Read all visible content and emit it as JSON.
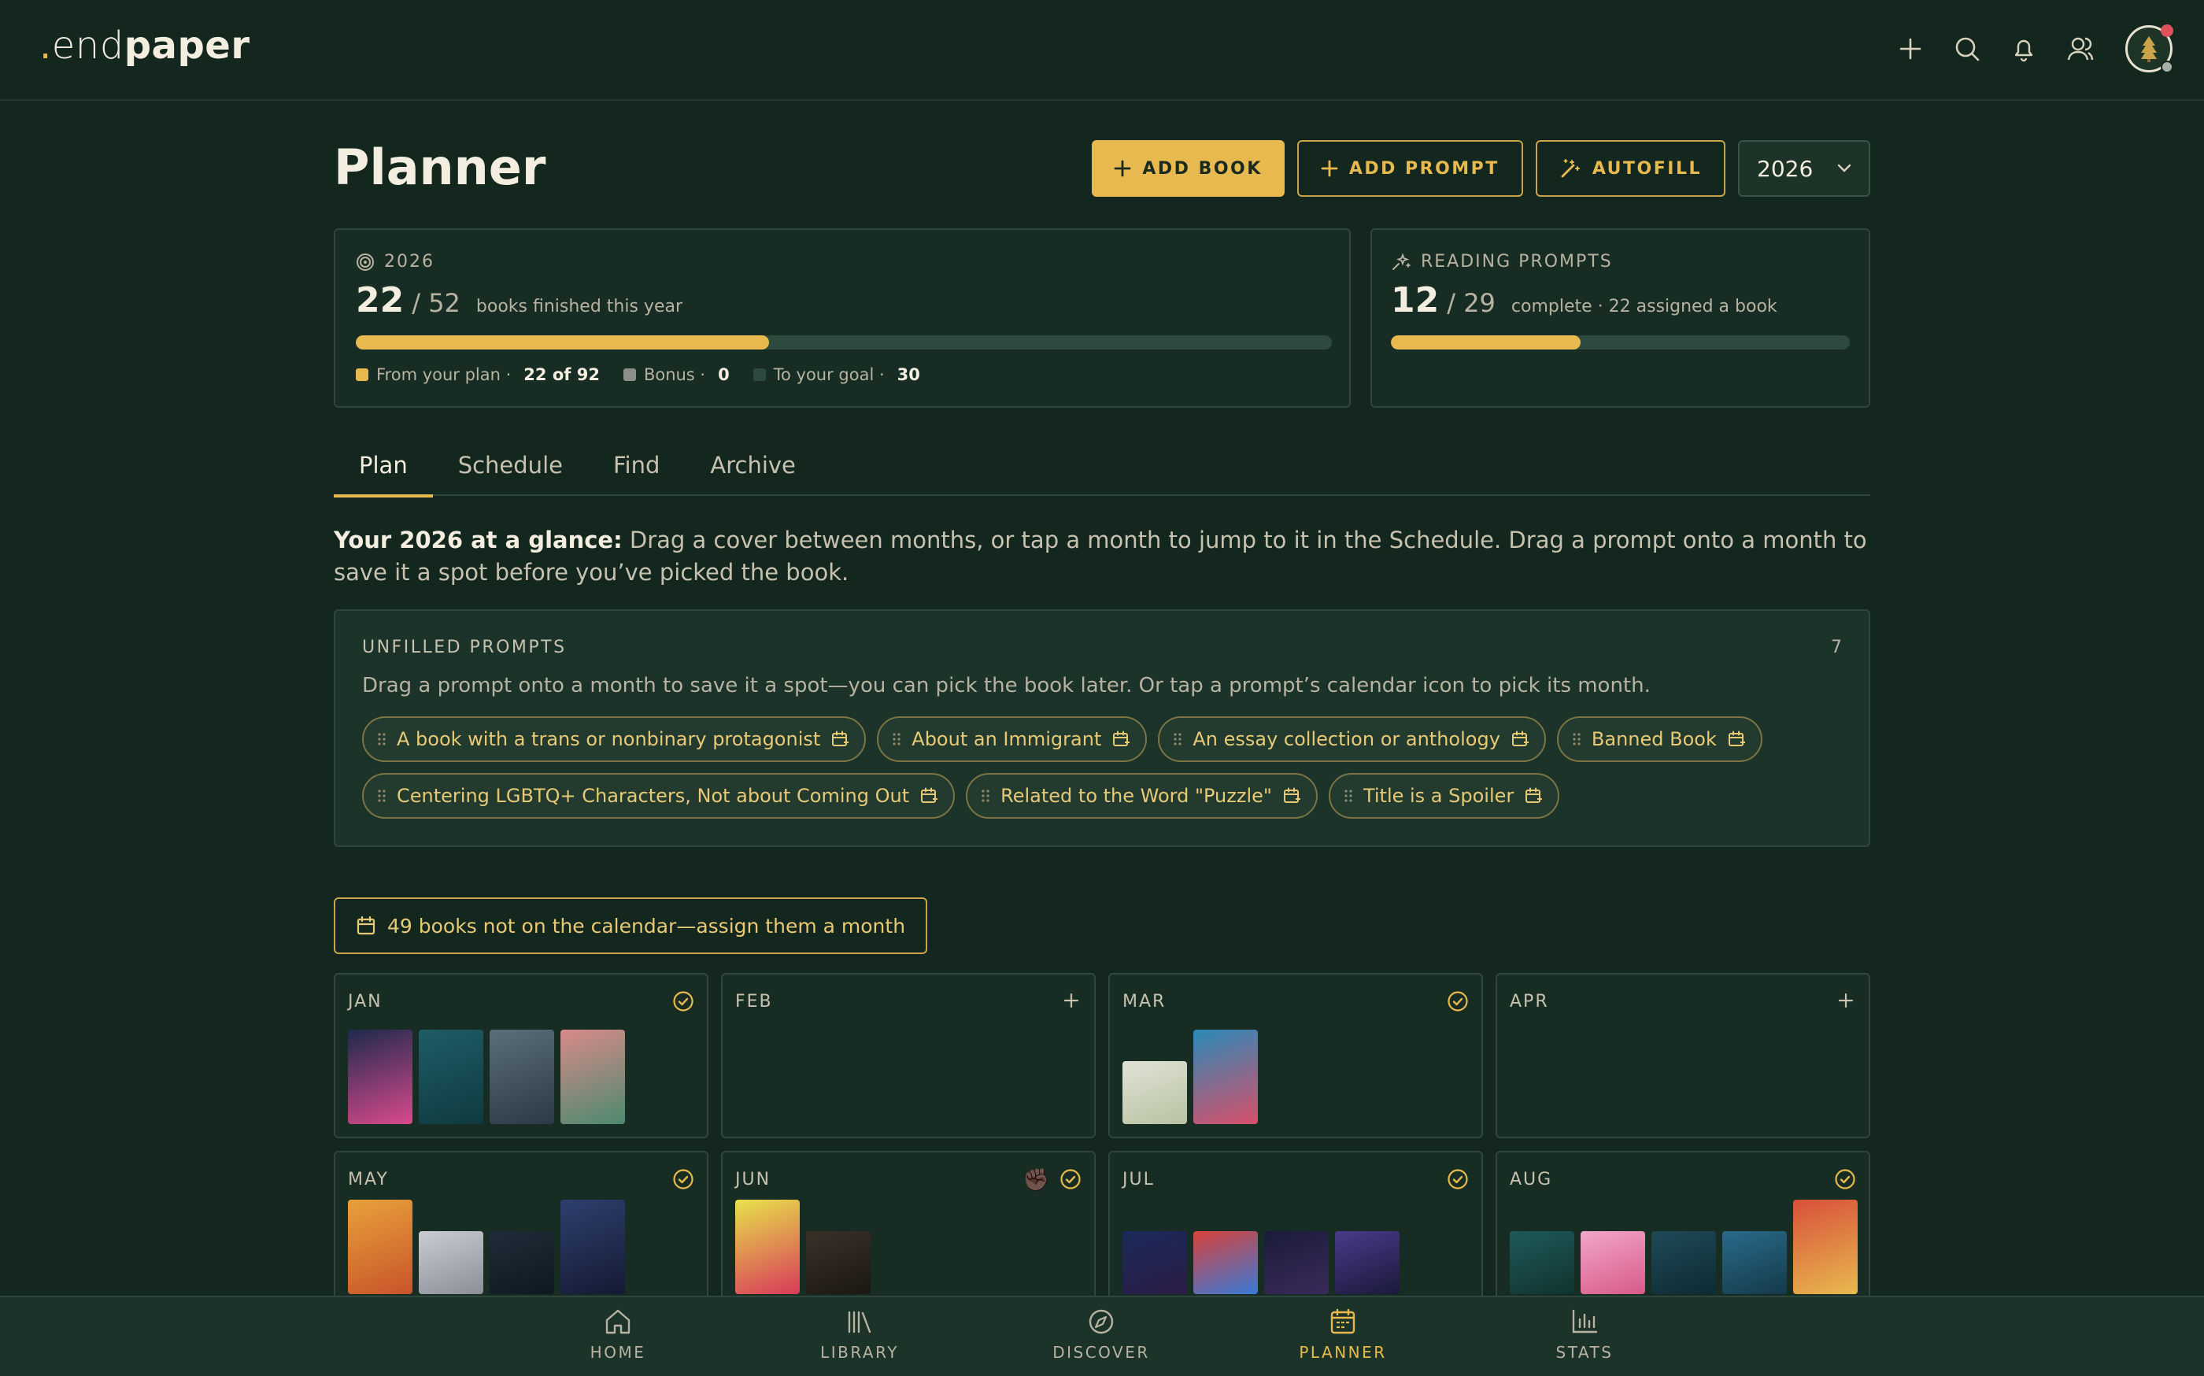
{
  "app": {
    "logo_dot": ".",
    "logo_end": "end",
    "logo_paper": "paper"
  },
  "header": {
    "title": "Planner"
  },
  "actions": {
    "add_book": "ADD BOOK",
    "add_prompt": "ADD PROMPT",
    "autofill": "AUTOFILL",
    "year": "2026"
  },
  "goal_card": {
    "label": "2026",
    "count": "22",
    "total": "/ 52",
    "caption": "books finished this year",
    "progress": 0.423,
    "legend": [
      {
        "label": "From your plan ·",
        "value": "22 of 92",
        "color": "#e8b94e"
      },
      {
        "label": "Bonus ·",
        "value": "0",
        "color": "#8c8f87"
      },
      {
        "label": "To your goal ·",
        "value": "30",
        "color": "#2e4a3e"
      }
    ]
  },
  "prompts_card": {
    "label": "READING PROMPTS",
    "count": "12",
    "total": "/ 29",
    "caption": "complete · 22 assigned a book",
    "progress": 0.414
  },
  "tabs": [
    {
      "label": "Plan",
      "active": true
    },
    {
      "label": "Schedule",
      "active": false
    },
    {
      "label": "Find",
      "active": false
    },
    {
      "label": "Archive",
      "active": false
    }
  ],
  "intro": {
    "bold": "Your 2026 at a glance:",
    "text": " Drag a cover between months, or tap a month to jump to it in the Schedule. Drag a prompt onto a month to save it a spot before you’ve picked the book."
  },
  "unfilled": {
    "title": "UNFILLED PROMPTS",
    "count": "7",
    "description": "Drag a prompt onto a month to save it a spot—you can pick the book later. Or tap a prompt’s calendar icon to pick its month.",
    "chips": [
      "A book with a trans or nonbinary protagonist",
      "About an Immigrant",
      "An essay collection or anthology",
      "Banned Book",
      "Centering LGBTQ+ Characters, Not about Coming Out",
      "Related to the Word \"Puzzle\"",
      "Title is a Spoiler"
    ]
  },
  "unassigned": {
    "label": "49 books not on the calendar—assign them a month"
  },
  "months": [
    {
      "label": "JAN",
      "icon": "check-circle-icon",
      "covers": [
        [
          "#1d2a4d",
          "#d94a8c"
        ],
        [
          "#1f5c66",
          "#0f3a40"
        ],
        [
          "#5b6e7a",
          "#2b3a44"
        ],
        [
          "#d88a8a",
          "#4d8a6e"
        ]
      ]
    },
    {
      "label": "FEB",
      "icon": "plus-icon",
      "covers": []
    },
    {
      "label": "MAR",
      "icon": "check-circle-icon",
      "covers": [
        [
          "#dfe3d6",
          "#b8c2a2"
        ],
        [
          "#2a8ab8",
          "#d8506a"
        ]
      ]
    },
    {
      "label": "APR",
      "icon": "plus-icon",
      "covers": []
    },
    {
      "label": "MAY",
      "icon": "check-circle-icon",
      "covers": [
        [
          "#e8a13a",
          "#c8542a"
        ],
        [
          "#c9ccd2",
          "#8a8f98"
        ],
        [
          "#1f2d38",
          "#0e1820"
        ],
        [
          "#2e3f6e",
          "#141a33"
        ]
      ]
    },
    {
      "label": "JUN",
      "icon": "check-circle-icon",
      "extra": "✊🏿",
      "covers": [
        [
          "#e7e24a",
          "#d83a5a"
        ],
        [
          "#3a3028",
          "#1c1712"
        ]
      ]
    },
    {
      "label": "JUL",
      "icon": "check-circle-icon",
      "covers": [
        [
          "#1a2a5a",
          "#2b1c46"
        ],
        [
          "#d8423a",
          "#3a7ad8"
        ],
        [
          "#1a1c3a",
          "#3a2a5a"
        ],
        [
          "#4a3a8a",
          "#1a1a3a"
        ]
      ]
    },
    {
      "label": "AUG",
      "icon": "check-circle-icon",
      "covers": [
        [
          "#1e5a58",
          "#103330"
        ],
        [
          "#f1a6c8",
          "#d85a8a"
        ],
        [
          "#1e4a58",
          "#0e2a33"
        ],
        [
          "#2a6a8a",
          "#143a4a"
        ],
        [
          "#d8503a",
          "#e8b94e"
        ]
      ]
    }
  ],
  "nav": [
    {
      "label": "HOME",
      "icon": "home-icon",
      "active": false
    },
    {
      "label": "LIBRARY",
      "icon": "library-icon",
      "active": false
    },
    {
      "label": "DISCOVER",
      "icon": "compass-icon",
      "active": false
    },
    {
      "label": "PLANNER",
      "icon": "calendar-icon",
      "active": true
    },
    {
      "label": "STATS",
      "icon": "chart-icon",
      "active": false
    }
  ]
}
